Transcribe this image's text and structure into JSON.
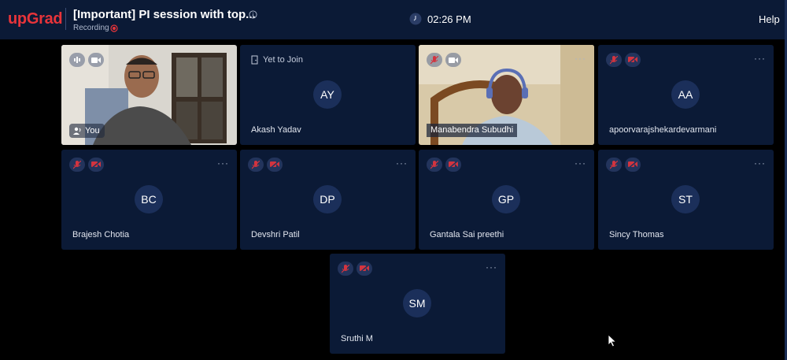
{
  "header": {
    "logo": "upGrad",
    "title": "[Important] PI session with top...",
    "recording_label": "Recording",
    "time": "02:26 PM",
    "help_label": "Help"
  },
  "participants": [
    {
      "initials": "",
      "name": "You",
      "video": true,
      "self": true
    },
    {
      "initials": "AY",
      "name": "Akash Yadav",
      "status": "Yet to Join"
    },
    {
      "initials": "",
      "name": "Manabendra Subudhi",
      "video": true
    },
    {
      "initials": "AA",
      "name": "apoorvarajshekardevarmani"
    },
    {
      "initials": "BC",
      "name": "Brajesh Chotia"
    },
    {
      "initials": "DP",
      "name": "Devshri Patil"
    },
    {
      "initials": "GP",
      "name": "Gantala Sai preethi"
    },
    {
      "initials": "ST",
      "name": "Sincy Thomas"
    },
    {
      "initials": "SM",
      "name": "Sruthi M"
    }
  ],
  "more_glyph": "···",
  "colors": {
    "brand": "#e8343a",
    "tile_bg": "#0b1a36",
    "avatar_bg": "#1b2f5a",
    "muted_red": "#d3343f"
  }
}
